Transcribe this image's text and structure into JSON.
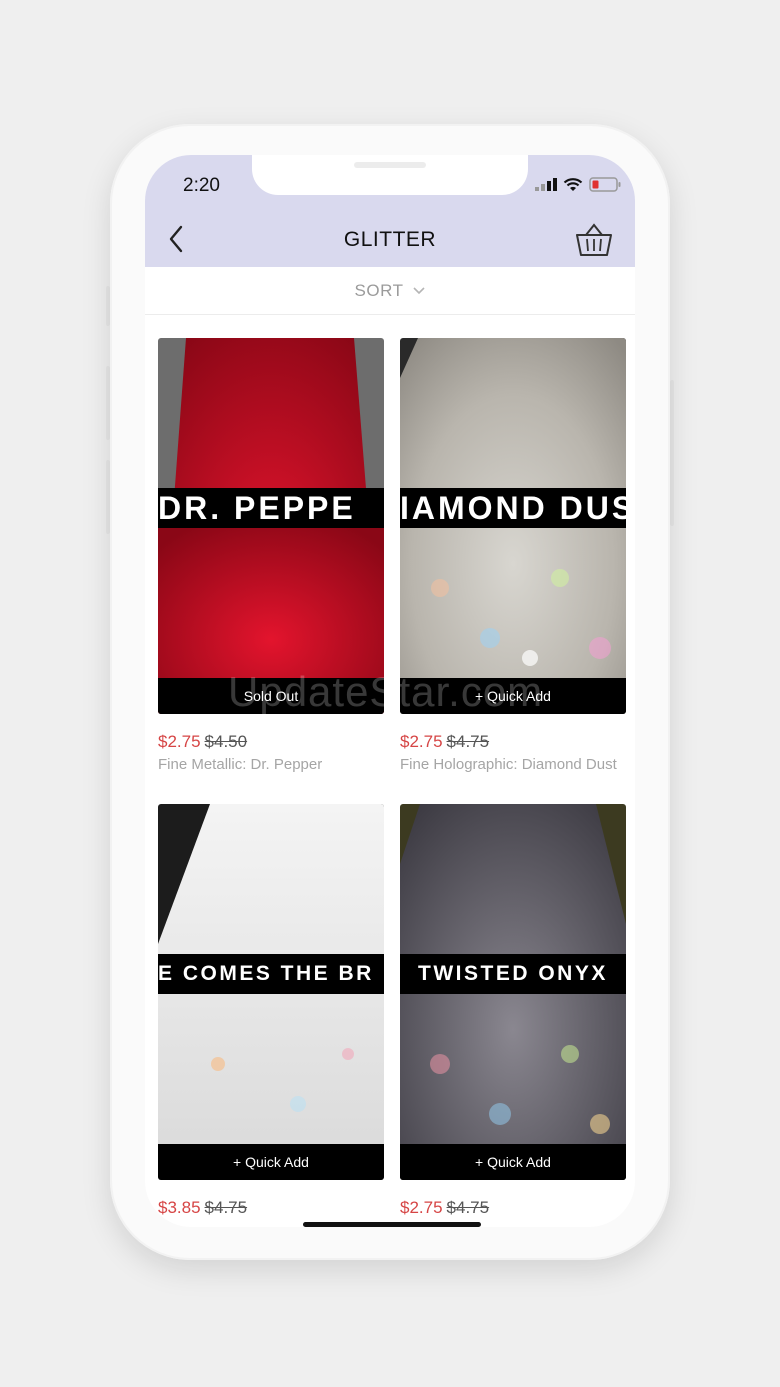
{
  "status": {
    "time": "2:20"
  },
  "nav": {
    "title": "GLITTER",
    "back_icon": "chevron-left-icon",
    "basket_icon": "basket-icon"
  },
  "sort": {
    "label": "SORT"
  },
  "products": [
    {
      "banner": "DR. PEPPE",
      "action": "Sold Out",
      "price": "$2.75",
      "old_price": "$4.50",
      "name": "Fine Metallic: Dr. Pepper",
      "sparkle_color": "#c8102e"
    },
    {
      "banner": "IAMOND DUS",
      "action": "+ Quick Add",
      "price": "$2.75",
      "old_price": "$4.75",
      "name": "Fine Holographic: Diamond Dust",
      "sparkle_color": "#c9c9c9"
    },
    {
      "banner": "E COMES THE BR",
      "action": "+ Quick Add",
      "price": "$3.85",
      "old_price": "$4.75",
      "name": "",
      "sparkle_color": "#e8e8e8"
    },
    {
      "banner": "TWISTED ONYX",
      "action": "+ Quick Add",
      "price": "$2.75",
      "old_price": "$4.75",
      "name": "",
      "sparkle_color": "#6a6a6a"
    }
  ],
  "watermark": "UpdateStar.com"
}
